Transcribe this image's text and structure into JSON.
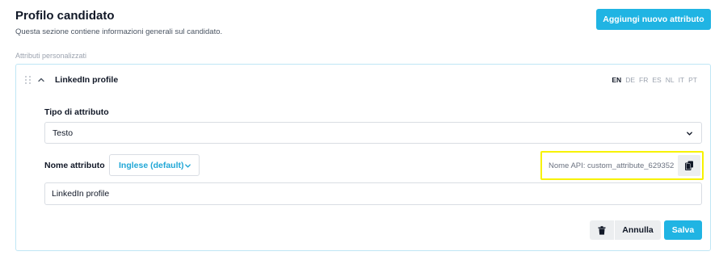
{
  "header": {
    "title": "Profilo candidato",
    "subtitle": "Questa sezione contiene informazioni generali sul candidato.",
    "add_button_label": "Aggiungi nuovo attributo"
  },
  "section_label": "Attributi personalizzati",
  "attribute": {
    "title": "LinkedIn profile",
    "languages": [
      {
        "code": "EN",
        "active": true
      },
      {
        "code": "DE",
        "active": false
      },
      {
        "code": "FR",
        "active": false
      },
      {
        "code": "ES",
        "active": false
      },
      {
        "code": "NL",
        "active": false
      },
      {
        "code": "IT",
        "active": false
      },
      {
        "code": "PT",
        "active": false
      }
    ],
    "type_label": "Tipo di attributo",
    "type_value": "Testo",
    "name_label": "Nome attributo",
    "language_selector": "Inglese (default)",
    "api_name": "Nome API: custom_attribute_629352",
    "name_value": "LinkedIn profile",
    "cancel_label": "Annulla",
    "save_label": "Salva"
  },
  "colors": {
    "accent": "#20b4e3",
    "highlight": "#f7f200",
    "card_border": "#bfe6f5"
  },
  "icons": {
    "drag": "drag-handle-icon",
    "collapse": "chevron-up-icon",
    "select": "chevron-down-icon",
    "copy": "copy-icon",
    "delete": "trash-icon"
  }
}
